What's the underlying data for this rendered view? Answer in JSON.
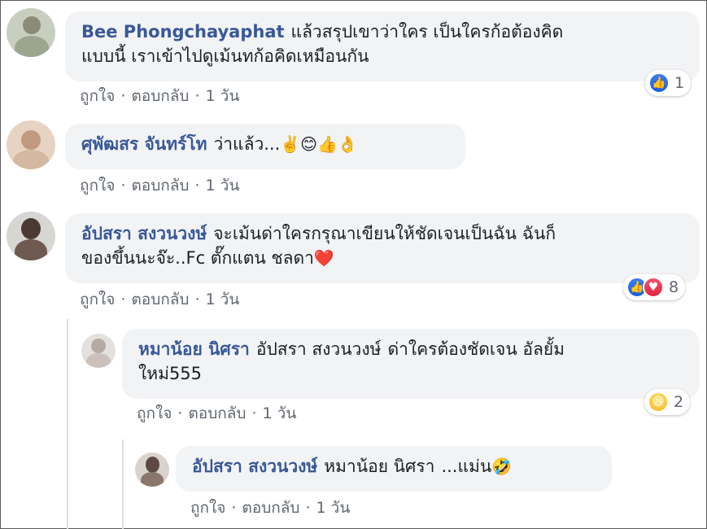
{
  "comments": [
    {
      "name": "Bee Phongchayaphat",
      "text_line1": "แล้วสรุปเขาว่าใคร เป็นใครก้อต้องคิด",
      "text_line2": "แบบนี้ เราเข้าไปดูเม้นทก้อคิดเหมือนกัน",
      "like": "ถูกใจ",
      "reply": "ตอบกลับ",
      "time": "1 วัน",
      "reaction_count": "1"
    },
    {
      "name": "ศุพัฒสร จันทร์โท",
      "text": "ว่าแล้ว...",
      "emojis": "✌️😊👍👌",
      "like": "ถูกใจ",
      "reply": "ตอบกลับ",
      "time": "1 วัน"
    },
    {
      "name": "อัปสรา สงวนวงษ์",
      "text_line1": "จะเม้นด่าใครกรุณาเขียนให้ชัดเจนเป็นฉัน ฉันก็",
      "text_line2": "ของขึ้นนะจ๊ะ..Fc ตั๊กแตน ชลดา",
      "heart": "❤️",
      "like": "ถูกใจ",
      "reply": "ตอบกลับ",
      "time": "1 วัน",
      "reaction_count": "8"
    },
    {
      "name": "หมาน้อย นิศรา",
      "tag": "อัปสรา สงวนวงษ์",
      "text_line1": "ด่าใครต้องชัดเจน อัลยั้ม",
      "text_line2": "ใหม่555",
      "like": "ถูกใจ",
      "reply": "ตอบกลับ",
      "time": "1 วัน",
      "reaction_count": "2"
    },
    {
      "name": "อัปสรา สงวนวงษ์",
      "tag": "หมาน้อย นิศรา",
      "text": "...แม่น",
      "emoji": "🤣",
      "like": "ถูกใจ",
      "reply": "ตอบกลับ",
      "time": "1 วัน"
    }
  ],
  "separator": "·",
  "icons": {
    "like": "thumbs-up",
    "love": "heart",
    "haha": "laughing-face"
  },
  "colors": {
    "name": "#385898",
    "bubble": "#f2f3f5",
    "meta": "#606770",
    "like_blue": "#1560e0",
    "love_red": "#e0253d"
  }
}
